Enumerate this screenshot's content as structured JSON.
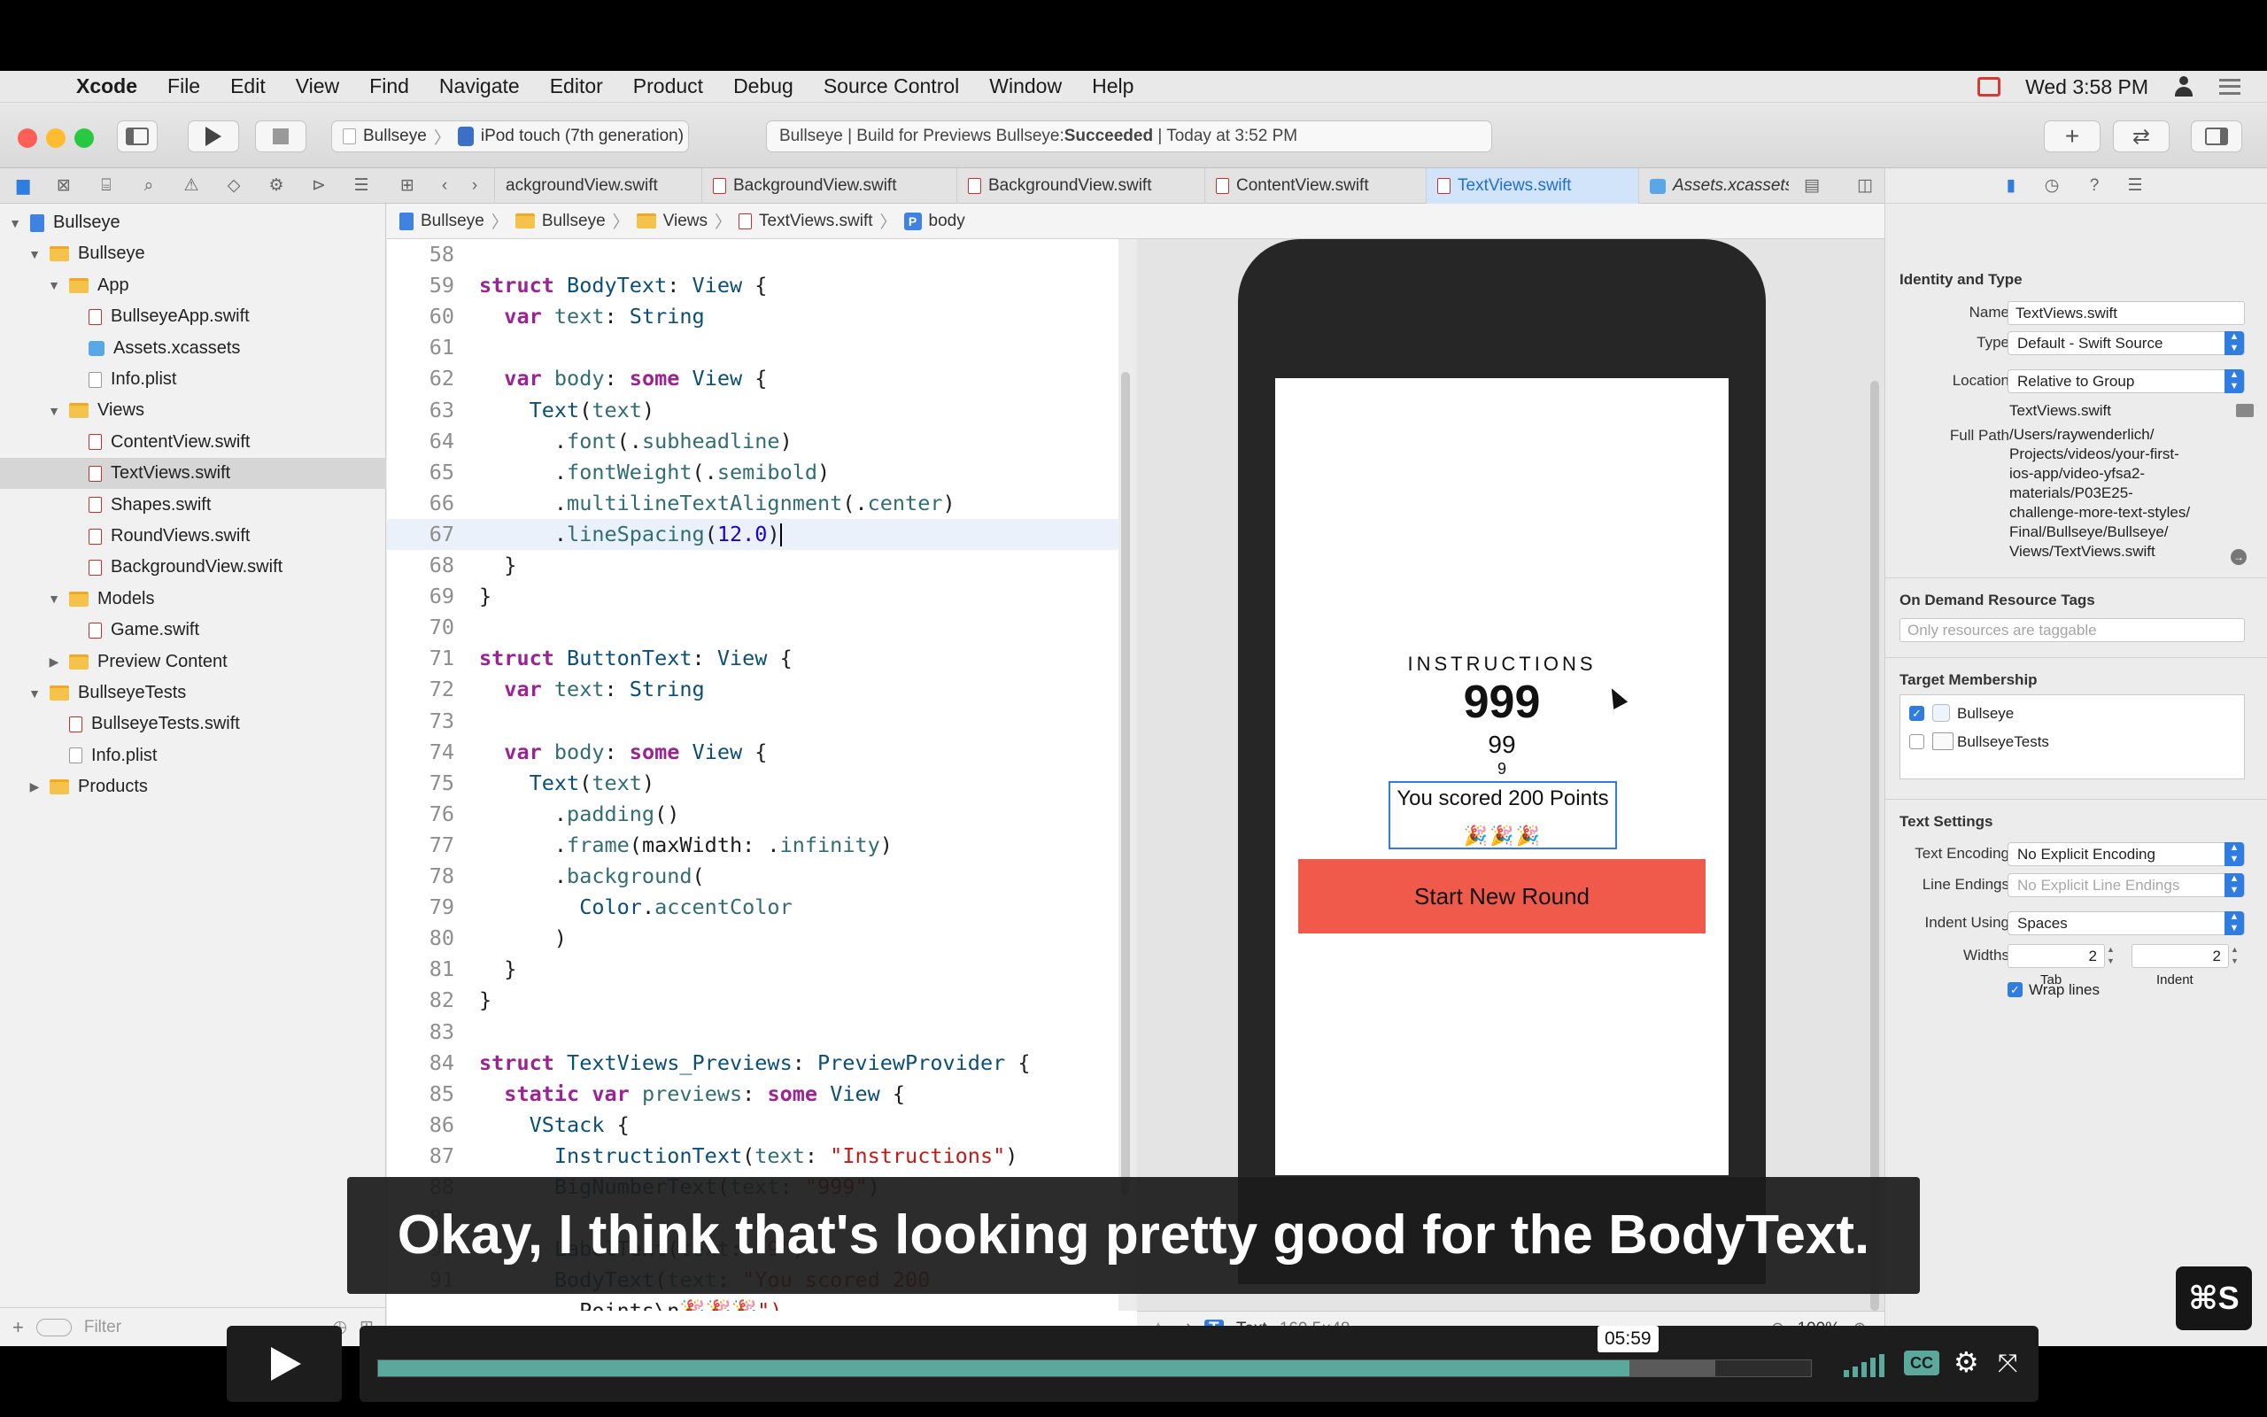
{
  "menubar": {
    "app": "Xcode",
    "items": [
      "File",
      "Edit",
      "View",
      "Find",
      "Navigate",
      "Editor",
      "Product",
      "Debug",
      "Source Control",
      "Window",
      "Help"
    ],
    "clock": "Wed 3:58 PM"
  },
  "toolbar": {
    "scheme": "Bullseye",
    "device": "iPod touch (7th generation)",
    "activity_prefix": "Bullseye | Build for Previews Bullseye: ",
    "activity_status": "Succeeded",
    "activity_suffix": " | Today at 3:52 PM"
  },
  "tabs": [
    {
      "label": "ackgroundView.swift",
      "icon": "swift-file-icon"
    },
    {
      "label": "BackgroundView.swift",
      "icon": "swift-file-icon"
    },
    {
      "label": "BackgroundView.swift",
      "icon": "swift-file-icon"
    },
    {
      "label": "ContentView.swift",
      "icon": "swift-file-icon"
    },
    {
      "label": "TextViews.swift",
      "icon": "swift-file-icon",
      "active": true
    },
    {
      "label": "Assets.xcassets",
      "icon": "assets-icon"
    }
  ],
  "navigator": {
    "items": [
      {
        "label": "Bullseye",
        "kind": "project",
        "depth": 0,
        "disclosure": "open"
      },
      {
        "label": "Bullseye",
        "kind": "folder",
        "depth": 1,
        "disclosure": "open"
      },
      {
        "label": "App",
        "kind": "folder",
        "depth": 2,
        "disclosure": "open"
      },
      {
        "label": "BullseyeApp.swift",
        "kind": "swift",
        "depth": 3
      },
      {
        "label": "Assets.xcassets",
        "kind": "assets",
        "depth": 3
      },
      {
        "label": "Info.plist",
        "kind": "plist",
        "depth": 3
      },
      {
        "label": "Views",
        "kind": "folder",
        "depth": 2,
        "disclosure": "open"
      },
      {
        "label": "ContentView.swift",
        "kind": "swift",
        "depth": 3
      },
      {
        "label": "TextViews.swift",
        "kind": "swift",
        "depth": 3,
        "selected": true
      },
      {
        "label": "Shapes.swift",
        "kind": "swift",
        "depth": 3
      },
      {
        "label": "RoundViews.swift",
        "kind": "swift",
        "depth": 3
      },
      {
        "label": "BackgroundView.swift",
        "kind": "swift",
        "depth": 3
      },
      {
        "label": "Models",
        "kind": "folder",
        "depth": 2,
        "disclosure": "open"
      },
      {
        "label": "Game.swift",
        "kind": "swift",
        "depth": 3
      },
      {
        "label": "Preview Content",
        "kind": "folder",
        "depth": 2,
        "disclosure": "closed"
      },
      {
        "label": "BullseyeTests",
        "kind": "folder",
        "depth": 1,
        "disclosure": "open"
      },
      {
        "label": "BullseyeTests.swift",
        "kind": "swift",
        "depth": 2
      },
      {
        "label": "Info.plist",
        "kind": "plist",
        "depth": 2
      },
      {
        "label": "Products",
        "kind": "folder",
        "depth": 1,
        "disclosure": "closed"
      }
    ],
    "filter_placeholder": "Filter"
  },
  "jumpbar": [
    "Bullseye",
    "Bullseye",
    "Views",
    "TextViews.swift",
    "body"
  ],
  "code": {
    "current_line": 67,
    "lines": [
      {
        "n": "58",
        "t": ""
      },
      {
        "n": "59",
        "t": "struct BodyText: View {"
      },
      {
        "n": "60",
        "t": "  var text: String"
      },
      {
        "n": "61",
        "t": ""
      },
      {
        "n": "62",
        "t": "  var body: some View {"
      },
      {
        "n": "63",
        "t": "    Text(text)"
      },
      {
        "n": "64",
        "t": "      .font(.subheadline)"
      },
      {
        "n": "65",
        "t": "      .fontWeight(.semibold)"
      },
      {
        "n": "66",
        "t": "      .multilineTextAlignment(.center)"
      },
      {
        "n": "67",
        "t": "      .lineSpacing(12.0)"
      },
      {
        "n": "68",
        "t": "  }"
      },
      {
        "n": "69",
        "t": "}"
      },
      {
        "n": "70",
        "t": ""
      },
      {
        "n": "71",
        "t": "struct ButtonText: View {"
      },
      {
        "n": "72",
        "t": "  var text: String"
      },
      {
        "n": "73",
        "t": ""
      },
      {
        "n": "74",
        "t": "  var body: some View {"
      },
      {
        "n": "75",
        "t": "    Text(text)"
      },
      {
        "n": "76",
        "t": "      .padding()"
      },
      {
        "n": "77",
        "t": "      .frame(maxWidth: .infinity)"
      },
      {
        "n": "78",
        "t": "      .background("
      },
      {
        "n": "79",
        "t": "        Color.accentColor"
      },
      {
        "n": "80",
        "t": "      )"
      },
      {
        "n": "81",
        "t": "  }"
      },
      {
        "n": "82",
        "t": "}"
      },
      {
        "n": "83",
        "t": ""
      },
      {
        "n": "84",
        "t": "struct TextViews_Previews: PreviewProvider {"
      },
      {
        "n": "85",
        "t": "  static var previews: some View {"
      },
      {
        "n": "86",
        "t": "    VStack {"
      },
      {
        "n": "87",
        "t": "      InstructionText(text: \"Instructions\")"
      },
      {
        "n": "88",
        "t": "      BigNumberText(text: \"999\")"
      },
      {
        "n": "89",
        "t": ""
      },
      {
        "n": "90",
        "t": "      LabelText(text: \"9\")"
      },
      {
        "n": "91",
        "t": "      BodyText(text: \"You scored 200"
      },
      {
        "n": "",
        "t": "        Points\\n🎉🎉🎉\")"
      }
    ]
  },
  "preview": {
    "instructions": "INSTRUCTIONS",
    "big_number": "999",
    "number_99": "99",
    "number_9": "9",
    "body_text": "You scored 200 Points",
    "body_emoji": "🎉🎉🎉",
    "button": "Start New Round"
  },
  "canvas_bar": {
    "element_label": "Text",
    "element_size": "160.5×48",
    "zoom": "100%"
  },
  "inspector": {
    "identity_title": "Identity and Type",
    "name_label": "Name",
    "name_value": "TextViews.swift",
    "type_label": "Type",
    "type_value": "Default - Swift Source",
    "location_label": "Location",
    "location_value": "Relative to Group",
    "location_file": "TextViews.swift",
    "fullpath_label": "Full Path",
    "fullpath_lines": [
      "/Users/raywenderlich/",
      "Projects/videos/your-first-",
      "ios-app/video-yfsa2-",
      "materials/P03E25-",
      "challenge-more-text-styles/",
      "Final/Bullseye/Bullseye/",
      "Views/TextViews.swift"
    ],
    "odr_title": "On Demand Resource Tags",
    "odr_placeholder": "Only resources are taggable",
    "target_title": "Target Membership",
    "targets": [
      {
        "label": "Bullseye",
        "checked": true
      },
      {
        "label": "BullseyeTests",
        "checked": false
      }
    ],
    "text_settings_title": "Text Settings",
    "encoding_label": "Text Encoding",
    "encoding_value": "No Explicit Encoding",
    "line_endings_label": "Line Endings",
    "line_endings_value": "No Explicit Line Endings",
    "indent_label": "Indent Using",
    "indent_value": "Spaces",
    "widths_label": "Widths",
    "tab_width": "2",
    "indent_width": "2",
    "tab_caption": "Tab",
    "indent_caption": "Indent",
    "wrap_label": "Wrap lines"
  },
  "caption": "Okay, I think that's looking pretty good for the BodyText.",
  "player": {
    "time": "05:59",
    "progress": 0.873,
    "buffered": 0.933,
    "cc_label": "CC"
  },
  "watermark": "⌘S",
  "colors": {
    "accent": "#2f7de1",
    "button_red": "#ef5a4a",
    "progress": "#5aa99c"
  }
}
